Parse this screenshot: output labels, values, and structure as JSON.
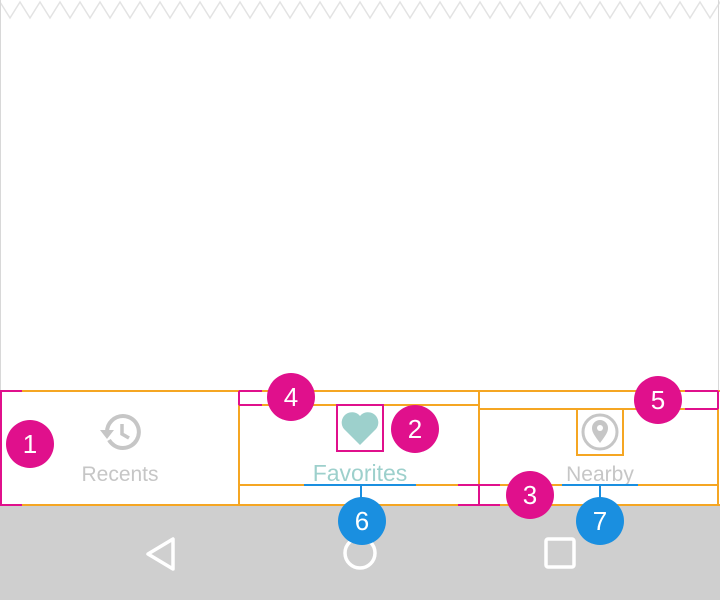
{
  "bottom_navigation": {
    "items": [
      {
        "label": "Recents",
        "icon": "history-icon",
        "active": false
      },
      {
        "label": "Favorites",
        "icon": "heart-icon",
        "active": true
      },
      {
        "label": "Nearby",
        "icon": "location-pin-icon",
        "active": false
      }
    ]
  },
  "system_navigation": {
    "buttons": [
      {
        "icon": "back-triangle-icon"
      },
      {
        "icon": "home-circle-icon"
      },
      {
        "icon": "recents-square-icon"
      }
    ]
  },
  "annotations": {
    "badges": [
      {
        "number": "1",
        "kind": "pink"
      },
      {
        "number": "2",
        "kind": "pink"
      },
      {
        "number": "3",
        "kind": "pink"
      },
      {
        "number": "4",
        "kind": "pink"
      },
      {
        "number": "5",
        "kind": "pink"
      },
      {
        "number": "6",
        "kind": "blue"
      },
      {
        "number": "7",
        "kind": "blue"
      }
    ]
  },
  "colors": {
    "active": "#9dd0cc",
    "inactive": "#c6c6c6",
    "guide_orange": "#f5a623",
    "guide_pink": "#e0108c",
    "guide_blue": "#1a8fe0",
    "sysnav_bg": "#cfcfcf"
  }
}
